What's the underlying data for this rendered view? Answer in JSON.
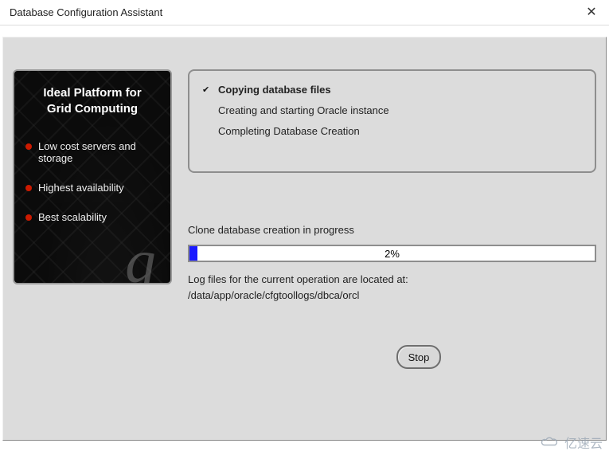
{
  "window": {
    "title": "Database Configuration Assistant"
  },
  "banner": {
    "title_line1": "Ideal Platform for",
    "title_line2": "Grid Computing",
    "bullets": [
      "Low cost servers and storage",
      "Highest availability",
      "Best scalability"
    ]
  },
  "steps": [
    {
      "label": "Copying database files",
      "current": true
    },
    {
      "label": "Creating and starting Oracle instance",
      "current": false
    },
    {
      "label": "Completing Database Creation",
      "current": false
    }
  ],
  "progress": {
    "status": "Clone database creation in progress",
    "percent": 2,
    "percent_label": "2%"
  },
  "log": {
    "line1": "Log files for the current operation are located at:",
    "line2": "/data/app/oracle/cfgtoollogs/dbca/orcl"
  },
  "buttons": {
    "stop": "Stop"
  },
  "watermark": {
    "text": "亿速云"
  }
}
